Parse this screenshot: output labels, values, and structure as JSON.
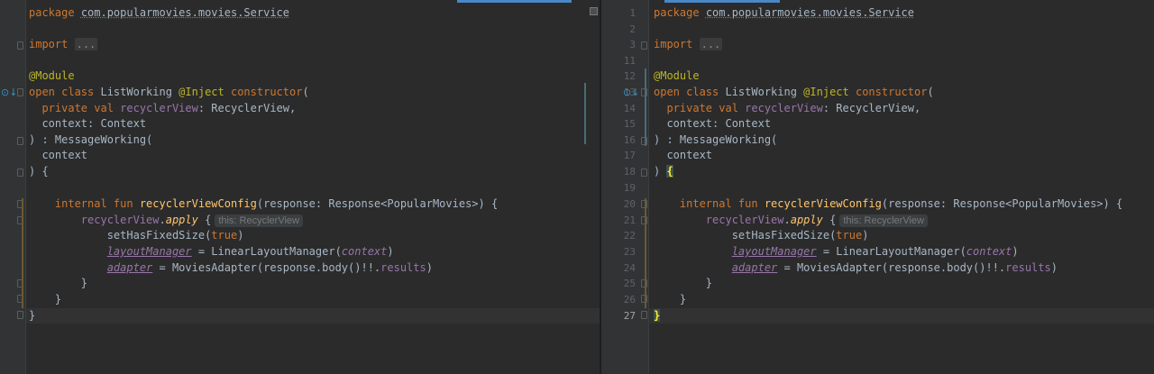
{
  "left_editor": {
    "lines": {
      "l1_pkg_kw": "package",
      "l1_pkg_name": "com.popularmovies.movies.Service",
      "l3_import": "import",
      "l3_dots": "...",
      "l5_annotation": "@Module",
      "l6_open": "open class",
      "l6_class": " ListWorking ",
      "l6_inject": "@Inject",
      "l6_ctor": " constructor",
      "l6_paren": "(",
      "l7_private": "  private val",
      "l7_prop": " recyclerView",
      "l7_type": ": RecyclerView,",
      "l8_ctx": "  context: Context",
      "l9_msg": ") : MessageWorking(",
      "l10_ctx": "  context",
      "l11_brace": ") {",
      "l13_internal": "    internal fun",
      "l13_fn": " recyclerViewConfig",
      "l13_params": "(response: Response<PopularMovies>) {",
      "l14_rv": "        recyclerView",
      "l14_dot": ".",
      "l14_apply": "apply",
      "l14_brace": " {",
      "l14_hint": "this: RecyclerView",
      "l15_set": "            setHasFixedSize(",
      "l15_true": "true",
      "l15_close": ")",
      "l16_indent": "            ",
      "l16_lm": "layoutManager",
      "l16_eq": " = LinearLayoutManager(",
      "l16_ctx": "context",
      "l16_close": ")",
      "l17_indent": "            ",
      "l17_adapter": "adapter",
      "l17_eq": " = MoviesAdapter(response.body()!!.",
      "l17_results": "results",
      "l17_close": ")",
      "l18_brace": "        }",
      "l19_brace": "    }",
      "l20_brace": "}"
    }
  },
  "right_editor": {
    "line_numbers": [
      "1",
      "2",
      "3",
      "11",
      "12",
      "13",
      "14",
      "15",
      "16",
      "17",
      "18",
      "19",
      "20",
      "21",
      "22",
      "23",
      "24",
      "25",
      "26",
      "27"
    ],
    "lines": {
      "r1_pkg_kw": "package",
      "r1_pkg_name": "com.popularmovies.movies.Service",
      "r3_import": "import",
      "r3_dots": "...",
      "r12_annotation": "@Module",
      "r13_open": "open class",
      "r13_class": " ListWorking ",
      "r13_inject": "@Inject",
      "r13_ctor": " constructor",
      "r13_paren": "(",
      "r14_private": "  private val",
      "r14_prop": " recyclerView",
      "r14_type": ": RecyclerView,",
      "r15_ctx": "  context: Context",
      "r16_msg": ") : MessageWorking(",
      "r17_ctx": "  context",
      "r18_paren": ") ",
      "r18_brace": "{",
      "r20_internal": "    internal fun",
      "r20_fn": " recyclerViewConfig",
      "r20_params": "(response: Response<PopularMovies>) {",
      "r21_rv": "        recyclerView",
      "r21_dot": ".",
      "r21_apply": "apply",
      "r21_brace": " {",
      "r21_hint": "this: RecyclerView",
      "r22_set": "            setHasFixedSize(",
      "r22_true": "true",
      "r22_close": ")",
      "r23_indent": "            ",
      "r23_lm": "layoutManager",
      "r23_eq": " = LinearLayoutManager(",
      "r23_ctx": "context",
      "r23_close": ")",
      "r24_indent": "            ",
      "r24_adapter": "adapter",
      "r24_eq": " = MoviesAdapter(response.body()!!.",
      "r24_results": "results",
      "r24_close": ")",
      "r25_brace": "        }",
      "r26_brace": "    }",
      "r27_brace": "}"
    }
  },
  "icons": {
    "override": "implements-override-icon",
    "fold": "fold-marker-icon"
  },
  "colors": {
    "background": "#2b2b2b",
    "gutter": "#313335",
    "keyword": "#cc7832",
    "annotation": "#bbb529",
    "function": "#ffc66d",
    "property": "#9876aa",
    "text": "#a9b7c6",
    "modified_bar": "#4a6a7a",
    "changed_bar": "#6b5a2f"
  }
}
